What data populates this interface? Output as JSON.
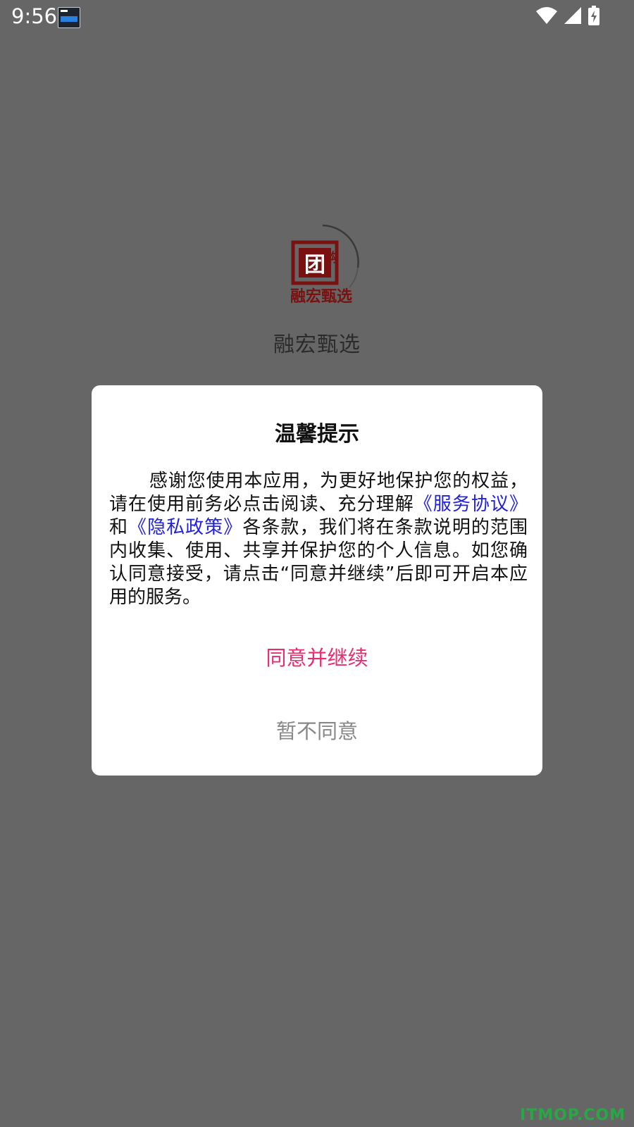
{
  "status_bar": {
    "time": "9:56",
    "icons": [
      "notification-icon",
      "wifi-icon",
      "signal-icon",
      "battery-charging-icon"
    ]
  },
  "splash": {
    "logo_text": "融宏甄选",
    "logo_badge": "团",
    "logo_badge2": "购",
    "app_name": "融宏甄选"
  },
  "dialog": {
    "title": "温馨提示",
    "body_part1": "感谢您使用本应用，为更好地保护您的权益，请在使用前务必点击阅读、充分理解",
    "service_link": "《服务协议》",
    "body_and": "和",
    "privacy_link": "《隐私政策》",
    "body_part2": "各条款，我们将在条款说明的范围内收集、使用、共享并保护您的个人信息。如您确认同意接受，请点击“同意并继续”后即可开启本应用的服务。",
    "agree_button": "同意并继续",
    "disagree_button": "暂不同意"
  },
  "watermark": "ITMOP.COM",
  "colors": {
    "overlay": "#666666",
    "link": "#2222dd",
    "agree": "#e62d6f",
    "disagree": "#888888"
  }
}
